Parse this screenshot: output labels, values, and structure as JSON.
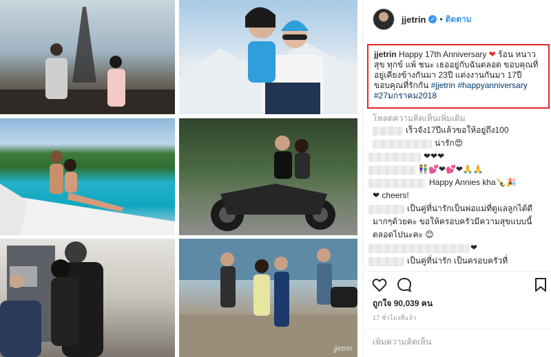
{
  "post": {
    "username": "jjetrin",
    "follow_label": "ติดตาม",
    "separator": "•",
    "caption_user": "jjetrin",
    "caption_text_1": "Happy 17th Anniversary",
    "caption_text_2": "ร้อน หนาว สุข ทุกข์ แพ้ ชนะ เธออยู่กับฉันตลอด ขอบคุณที่อยู่เคียงข้างกันมา 23ปี แต่งงานกันมา 17ปี ขอบคุณที่รักกัน",
    "hashtags": [
      "#jjetrin",
      "#happyanniversary",
      "#27มกราคม2018"
    ],
    "load_more": "โหลดความคิดเห็นเพิ่มเติม",
    "likes": "ถูกใจ 90,039 คน",
    "time": "17 ชั่วโมงที่แล้ว",
    "add_comment_placeholder": "เพิ่มความคิดเห็น",
    "watermark": "jjetrin"
  },
  "comments": [
    {
      "text": "เร็วจัง17ปีแล้วขอให้อยู่ถึง100"
    },
    {
      "text": "น่ารัก😍"
    },
    {
      "text": "❤❤❤"
    },
    {
      "text": "👫💕❤💕❤🙏🙏"
    },
    {
      "text": "Happy Annies kha🍾🎉"
    },
    {
      "text": "❤ cheers!"
    },
    {
      "text": "เป็นคู่ที่น่ารักเป็นพ่อแม่ที่ดูแลลูกได้ดี"
    },
    {
      "text": "มากๆด้วยคะ ขอให้ครอบครัวมีความสุขแบบนี้"
    },
    {
      "text": "ตลอดไปนะคะ 😊"
    },
    {
      "text": "❤"
    },
    {
      "text": "เป็นคู่ที่น่ารัก เป็นครอบครัวที่"
    }
  ],
  "icons": {
    "like": "heart-outline-icon",
    "comment": "speech-bubble-icon",
    "save": "bookmark-icon",
    "verified": "verified-badge-icon"
  },
  "colors": {
    "accent": "#3897f0",
    "highlight_border": "#e0252b",
    "heart": "#ed2a2a",
    "hashtag": "#003569"
  }
}
